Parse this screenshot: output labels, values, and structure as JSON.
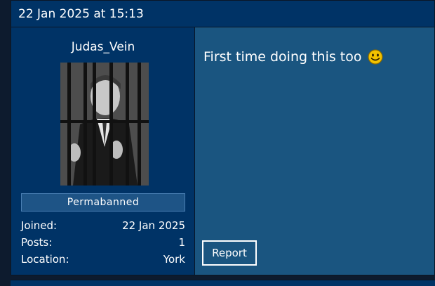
{
  "post": {
    "date": "22 Jan 2025 at 15:13",
    "author": {
      "username": "Judas_Vein",
      "avatar": "jail-bars-avatar-icon",
      "rank": "Permabanned",
      "stats": [
        {
          "label": "Joined:",
          "value": "22 Jan 2025"
        },
        {
          "label": "Posts:",
          "value": "1"
        },
        {
          "label": "Location:",
          "value": "York"
        }
      ]
    },
    "message": "First time doing this too",
    "emoticon": "smiley-icon",
    "report_label": "Report"
  },
  "colors": {
    "header_bg": "#003366",
    "content_bg": "#1a5580",
    "badge_bg": "#1e5486"
  }
}
